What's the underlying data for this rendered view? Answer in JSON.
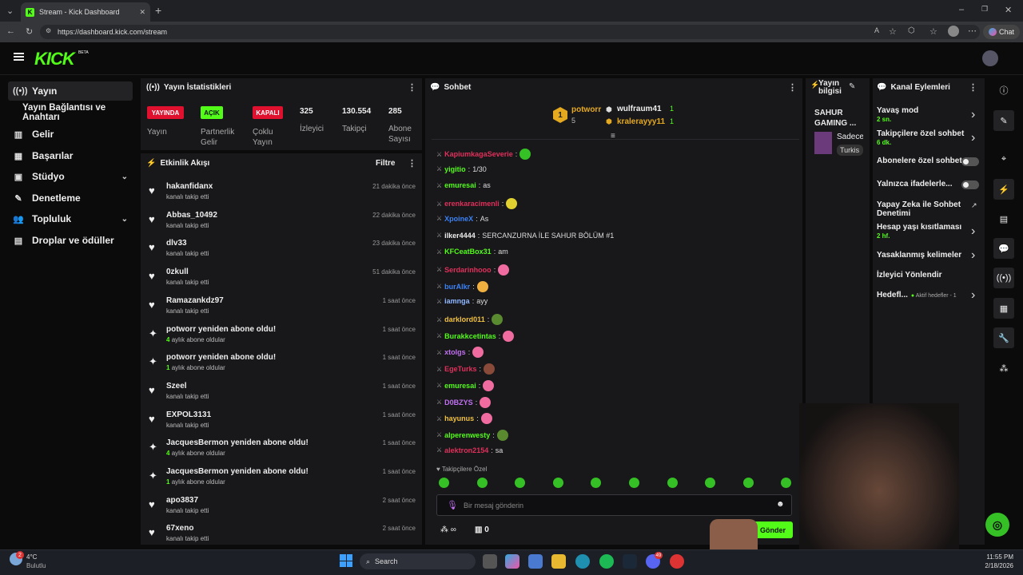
{
  "browser": {
    "tab_title": "Stream - Kick Dashboard",
    "url": "https://dashboard.kick.com/stream",
    "chat_button": "Chat"
  },
  "app": {
    "logo": "KICK",
    "beta": "BETA"
  },
  "sidebar": {
    "items": [
      {
        "label": "Yayın",
        "icon": "broadcast-icon"
      },
      {
        "label": "Yayın Bağlantısı ve Anahtarı",
        "icon": ""
      },
      {
        "label": "Gelir",
        "icon": "revenue-icon"
      },
      {
        "label": "Başarılar",
        "icon": "achievements-icon"
      },
      {
        "label": "Stüdyo",
        "icon": "studio-icon"
      },
      {
        "label": "Denetleme",
        "icon": "moderation-icon"
      },
      {
        "label": "Topluluk",
        "icon": "community-icon"
      },
      {
        "label": "Droplar ve ödüller",
        "icon": "drops-icon"
      }
    ]
  },
  "stats": {
    "title": "Yayın İstatistikleri",
    "badges": [
      {
        "badge": "YAYINDA",
        "label": "Yayın",
        "color": "#e0102f"
      },
      {
        "badge": "AÇIK",
        "label": "Partnerlik Gelir",
        "color": "#53fc18"
      },
      {
        "badge": "KAPALI",
        "label": "Çoklu Yayın",
        "color": "#e0102f"
      }
    ],
    "numbers": [
      {
        "value": "325",
        "label": "İzleyici"
      },
      {
        "value": "130.554",
        "label": "Takipçi"
      },
      {
        "value": "285",
        "label": "Abone Sayısı"
      }
    ]
  },
  "activity": {
    "title": "Etkinlik Akışı",
    "filter": "Filtre",
    "items": [
      {
        "name": "hakanfidanx",
        "sub": "kanalı takip etti",
        "time": "21 dakika önce",
        "type": "follow"
      },
      {
        "name": "Abbas_10492",
        "sub": "kanalı takip etti",
        "time": "22 dakika önce",
        "type": "follow"
      },
      {
        "name": "dlv33",
        "sub": "kanalı takip etti",
        "time": "23 dakika önce",
        "type": "follow"
      },
      {
        "name": "0zkull",
        "sub": "kanalı takip etti",
        "time": "51 dakika önce",
        "type": "follow"
      },
      {
        "name": "Ramazankdz97",
        "sub": "kanalı takip etti",
        "time": "1 saat önce",
        "type": "follow"
      },
      {
        "name": "potworr yeniden abone oldu!",
        "subnum": "4",
        "sub": "aylık abone oldular",
        "time": "1 saat önce",
        "type": "sub"
      },
      {
        "name": "potworr yeniden abone oldu!",
        "subnum": "1",
        "sub": "aylık abone oldular",
        "time": "1 saat önce",
        "type": "sub"
      },
      {
        "name": "Szeel",
        "sub": "kanalı takip etti",
        "time": "1 saat önce",
        "type": "follow"
      },
      {
        "name": "EXPOL3131",
        "sub": "kanalı takip etti",
        "time": "1 saat önce",
        "type": "follow"
      },
      {
        "name": "JacquesBermon yeniden abone oldu!",
        "subnum": "4",
        "sub": "aylık abone oldular",
        "time": "1 saat önce",
        "type": "sub"
      },
      {
        "name": "JacquesBermon yeniden abone oldu!",
        "subnum": "1",
        "sub": "aylık abone oldular",
        "time": "1 saat önce",
        "type": "sub"
      },
      {
        "name": "apo3837",
        "sub": "kanalı takip etti",
        "time": "2 saat önce",
        "type": "follow"
      },
      {
        "name": "67xeno",
        "sub": "kanalı takip etti",
        "time": "2 saat önce",
        "type": "follow"
      }
    ]
  },
  "chat": {
    "title": "Sohbet",
    "top_gifters": [
      {
        "rank": "1",
        "name": "potworr",
        "count": "5"
      },
      {
        "name": "wulfraum41",
        "count": "1"
      },
      {
        "name": "kralerayyy11",
        "count": "1"
      }
    ],
    "messages": [
      {
        "user": "KapiumkagaSeverie",
        "color": "#e0305a",
        "text": "",
        "emote": "#35c025"
      },
      {
        "user": "yigitio",
        "color": "#53fc18",
        "text": "1/30"
      },
      {
        "user": "emuresai",
        "color": "#53fc18",
        "text": "as"
      },
      {
        "user": "erenkaracimenli",
        "color": "#e0305a",
        "text": "",
        "emote": "#e0d030"
      },
      {
        "user": "XpoineX",
        "color": "#3b82f6",
        "text": "As"
      },
      {
        "user": "ilker4444",
        "color": "#eee",
        "text": "SERCANZURNA İLE SAHUR BÖLÜM #1"
      },
      {
        "user": "KFCeatBox31",
        "color": "#53fc18",
        "text": "am"
      },
      {
        "user": "Serdarinhooo",
        "color": "#e0305a",
        "text": "",
        "emote": "#f06ca0"
      },
      {
        "user": "burAlkr",
        "color": "#3b82f6",
        "text": "",
        "emote": "#f0b040"
      },
      {
        "user": "iamnga",
        "color": "#8fb8ff",
        "text": "ayy"
      },
      {
        "user": "darklord011",
        "color": "#f0c040",
        "text": "",
        "emote": "#5a8a30"
      },
      {
        "user": "Burakkcetintas",
        "color": "#53fc18",
        "text": "",
        "emote": "#f06ca0"
      },
      {
        "user": "xtolgs",
        "color": "#c070f0",
        "text": "",
        "emote": "#f06ca0"
      },
      {
        "user": "EgeTurks",
        "color": "#e0305a",
        "text": "",
        "emote": "#8a4a3a"
      },
      {
        "user": "emuresai",
        "color": "#53fc18",
        "text": "",
        "emote": "#f06ca0"
      },
      {
        "user": "D0BZYS",
        "color": "#c070f0",
        "text": "",
        "emote": "#f06ca0"
      },
      {
        "user": "hayunus",
        "color": "#f0c040",
        "text": "",
        "emote": "#f06ca0"
      },
      {
        "user": "alperenwesty",
        "color": "#53fc18",
        "text": "",
        "emote": "#5a8a30"
      },
      {
        "user": "alektron2154",
        "color": "#e0305a",
        "text": "sa"
      }
    ],
    "followers_only": "Takipçilere Özel",
    "input_placeholder": "Bir mesaj gönderin",
    "points": "∞",
    "count": "0",
    "send": "Gönder"
  },
  "stream_info": {
    "title": "Yayın bilgisi",
    "stream_name": "SAHUR GAMING ...",
    "text1": "Sadece",
    "text2": "Turkis"
  },
  "channel_actions": {
    "title": "Kanal Eylemleri",
    "items": [
      {
        "label": "Yavaş mod",
        "sub": "2 sn.",
        "ctrl": "arrow"
      },
      {
        "label": "Takipçilere özel sohbet",
        "sub": "6 dk.",
        "ctrl": "arrow"
      },
      {
        "label": "Abonelere özel sohbet",
        "sub": "",
        "ctrl": "toggle"
      },
      {
        "label": "Yalnızca ifadelerle...",
        "sub": "",
        "ctrl": "toggle"
      },
      {
        "label": "Yapay Zeka ile Sohbet Denetimi",
        "sub": "",
        "ctrl": "ext"
      },
      {
        "label": "Hesap yaşı kısıtlaması",
        "sub": "2 hf.",
        "ctrl": "arrow"
      },
      {
        "label": "Yasaklanmış kelimeler",
        "sub": "",
        "ctrl": "arrow"
      },
      {
        "label": "İzleyici Yönlendir",
        "sub": "",
        "ctrl": "none"
      },
      {
        "label": "Hedefl...",
        "sub": "Aktif hedefler - 1",
        "ctrl": "arrow"
      }
    ]
  },
  "taskbar": {
    "weather_temp": "4°C",
    "weather_text": "Bulutlu",
    "weather_badge": "2",
    "search": "Search",
    "time": "11:55 PM",
    "date": "2/18/2026",
    "discord_badge": "49"
  }
}
